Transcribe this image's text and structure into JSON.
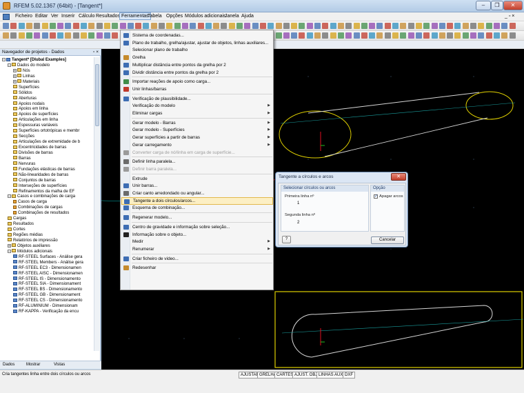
{
  "window": {
    "title": "RFEM 5.02.1367 (64bit) - [Tangent*]",
    "minimize": "–",
    "maximize": "❐",
    "close": "✕"
  },
  "menubar": {
    "items": [
      "Ficheiro",
      "Editar",
      "Ver",
      "Inserir",
      "Cálculo",
      "Resultados",
      "Ferramentas",
      "Tabela",
      "Opções",
      "Módulos adicionais",
      "Janela",
      "Ajuda"
    ],
    "active": "Ferramentas",
    "mdi_controls": "_ ▫ ×"
  },
  "navigator": {
    "title": "Navegador de projetos - Dados",
    "close": "▫ ×",
    "tree": [
      {
        "label": "Tangent* [Dlubal Examples]",
        "level": 0,
        "bold": true,
        "icon": "doc",
        "expander": "−"
      },
      {
        "label": "Dados do modelo",
        "level": 1,
        "icon": "folder",
        "expander": "−"
      },
      {
        "label": "Nós",
        "level": 2,
        "icon": "folder",
        "expander": "+"
      },
      {
        "label": "Linhas",
        "level": 2,
        "icon": "folder",
        "expander": "+"
      },
      {
        "label": "Materiais",
        "level": 2,
        "icon": "folder",
        "expander": "+"
      },
      {
        "label": "Superfícies",
        "level": 2,
        "icon": "folder"
      },
      {
        "label": "Sólidos",
        "level": 2,
        "icon": "folder"
      },
      {
        "label": "Aberturas",
        "level": 2,
        "icon": "folder"
      },
      {
        "label": "Apoios nodais",
        "level": 2,
        "icon": "folder"
      },
      {
        "label": "Apoios em linha",
        "level": 2,
        "icon": "folder"
      },
      {
        "label": "Apoios de superfícies",
        "level": 2,
        "icon": "folder"
      },
      {
        "label": "Articulações em linha",
        "level": 2,
        "icon": "folder"
      },
      {
        "label": "Espessuras variáveis",
        "level": 2,
        "icon": "folder"
      },
      {
        "label": "Superfícies ortotrópicas e membr",
        "level": 2,
        "icon": "folder"
      },
      {
        "label": "Secções",
        "level": 2,
        "icon": "folder"
      },
      {
        "label": "Articulações de extremidade de b",
        "level": 2,
        "icon": "folder"
      },
      {
        "label": "Excentricidades de barras",
        "level": 2,
        "icon": "folder"
      },
      {
        "label": "Divisões de barras",
        "level": 2,
        "icon": "folder"
      },
      {
        "label": "Barras",
        "level": 2,
        "icon": "folder"
      },
      {
        "label": "Nervuras",
        "level": 2,
        "icon": "folder"
      },
      {
        "label": "Fundações elásticas de barras",
        "level": 2,
        "icon": "folder"
      },
      {
        "label": "Não-linearidades de barras",
        "level": 2,
        "icon": "folder"
      },
      {
        "label": "Conjuntos de barras",
        "level": 2,
        "icon": "folder"
      },
      {
        "label": "Interseções de superfícies",
        "level": 2,
        "icon": "folder"
      },
      {
        "label": "Refinamentos da malha de EF",
        "level": 2,
        "icon": "folder"
      },
      {
        "label": "Casos e combinações de carga",
        "level": 1,
        "icon": "folder",
        "expander": "−"
      },
      {
        "label": "Casos de carga",
        "level": 2,
        "icon": "item"
      },
      {
        "label": "Combinações de cargas",
        "level": 2,
        "icon": "item"
      },
      {
        "label": "Combinações de resultados",
        "level": 2,
        "icon": "item"
      },
      {
        "label": "Cargas",
        "level": 1,
        "icon": "folder"
      },
      {
        "label": "Resultados",
        "level": 1,
        "icon": "folder"
      },
      {
        "label": "Cortes",
        "level": 1,
        "icon": "folder"
      },
      {
        "label": "Regiões médias",
        "level": 1,
        "icon": "folder"
      },
      {
        "label": "Relatórios de impressão",
        "level": 1,
        "icon": "folder"
      },
      {
        "label": "Objetos auxiliares",
        "level": 1,
        "icon": "folder",
        "expander": "+"
      },
      {
        "label": "Módulos adicionais",
        "level": 1,
        "icon": "folder",
        "expander": "−"
      },
      {
        "label": "RF-STEEL Surfaces - Análise gera",
        "level": 2,
        "icon": "doc"
      },
      {
        "label": "RF-STEEL Members - Análise gera",
        "level": 2,
        "icon": "doc"
      },
      {
        "label": "RF-STEEL EC3 - Dimensionamen",
        "level": 2,
        "icon": "doc"
      },
      {
        "label": "RF-STEEL AISC - Dimensionamen",
        "level": 2,
        "icon": "doc"
      },
      {
        "label": "RF-STEEL IS - Dimensionamento",
        "level": 2,
        "icon": "doc"
      },
      {
        "label": "RF-STEEL SIA - Dimensionament",
        "level": 2,
        "icon": "doc"
      },
      {
        "label": "RF-STEEL BS - Dimensionamento",
        "level": 2,
        "icon": "doc"
      },
      {
        "label": "RF-STEEL GB - Dimensionament",
        "level": 2,
        "icon": "doc"
      },
      {
        "label": "RF-STEEL CS - Dimensionamento",
        "level": 2,
        "icon": "doc"
      },
      {
        "label": "RF-ALUMINIUM - Dimensionam",
        "level": 2,
        "icon": "doc"
      },
      {
        "label": "RF-KAPPA - Verificação da encu",
        "level": 2,
        "icon": "doc"
      }
    ],
    "tabs": [
      "Dados",
      "Mostrar",
      "Vistas"
    ]
  },
  "tools_menu": {
    "items": [
      {
        "label": "Sistema de coordenadas...",
        "icon": "#3d6db3"
      },
      {
        "label": "Plano de trabalho, grelha/ajustar, ajustar de objetos, linhas auxiliares...",
        "icon": "#3d6db3"
      },
      {
        "label": "Selecionar plano de trabalho",
        "icon": ""
      },
      {
        "label": "Grelha",
        "icon": "#c58a2c"
      },
      {
        "label": "Multiplicar distância entre pontos da grelha por 2",
        "icon": "#3d6db3"
      },
      {
        "label": "Dividir distância entre pontos da grelha por 2",
        "icon": "#3d6db3"
      },
      {
        "sep": true
      },
      {
        "label": "Importar reações de apoio como carga...",
        "icon": "#3f8d4a"
      },
      {
        "label": "Unir linhas/barras",
        "icon": "#c0392b"
      },
      {
        "sep": true
      },
      {
        "label": "Verificação de plausibilidade...",
        "icon": "#3d6db3"
      },
      {
        "label": "Verificação do modelo",
        "icon": "",
        "submenu": true
      },
      {
        "label": "Eliminar cargas",
        "icon": "",
        "submenu": true
      },
      {
        "sep": true
      },
      {
        "label": "Gerar modelo - Barras",
        "icon": "",
        "submenu": true
      },
      {
        "label": "Gerar modelo - Superfícies",
        "icon": "",
        "submenu": true
      },
      {
        "label": "Gerar superfícies a partir de barras",
        "icon": "",
        "submenu": true
      },
      {
        "label": "Gerar carregamento",
        "icon": "",
        "submenu": true
      },
      {
        "label": "Converter carga de nó/linha em carga de superfície...",
        "icon": "#9a9a9a",
        "disabled": true
      },
      {
        "sep": true
      },
      {
        "label": "Definir linha paralela...",
        "icon": "#6b6b6b"
      },
      {
        "label": "Definir barra paralela...",
        "icon": "#9a9a9a",
        "disabled": true
      },
      {
        "sep": true
      },
      {
        "label": "Extrude",
        "icon": ""
      },
      {
        "label": "Unir barras...",
        "icon": "#3d6db3"
      },
      {
        "label": "Criar canto arredondado ou angular...",
        "icon": "#6b6b6b"
      },
      {
        "label": "Tangente a dois círculos/arcos...",
        "icon": "#3d6db3",
        "highlight": true
      },
      {
        "label": "Esquema de combinação...",
        "icon": "#3d6db3"
      },
      {
        "sep": true
      },
      {
        "label": "Regenerar modelo...",
        "icon": "#3d6db3"
      },
      {
        "sep": true
      },
      {
        "label": "Centro de gravidade e informação sobre seleção...",
        "icon": "#3d6db3"
      },
      {
        "label": "Informação sobre o objeto...",
        "icon": "#222222"
      },
      {
        "label": "Medir",
        "icon": "",
        "submenu": true
      },
      {
        "label": "Renumerar",
        "icon": "",
        "submenu": true
      },
      {
        "sep": true
      },
      {
        "label": "Criar ficheiro de vídeo...",
        "icon": "#3d6db3"
      },
      {
        "sep": true
      },
      {
        "label": "Redesenhar",
        "icon": "#c58a2c"
      }
    ]
  },
  "dialog": {
    "title": "Tangente a círculos e arcos",
    "close": "✕",
    "select_group": "Selecionar círculos ou arcos",
    "first_line_label": "Primeira linha nº",
    "first_line_value": "1",
    "second_line_label": "Segunda linha nº",
    "second_line_value": "2",
    "option_group": "Opção",
    "delete_arcs_label": "Apagar arcos",
    "delete_arcs_checked": "✓",
    "help": "?",
    "cancel": "Cancelar"
  },
  "statusbar": {
    "text": "Cria tangentes linha entre dois círculos ou arcos",
    "buttons": [
      "AJUSTAR",
      "GRELHA",
      "CARTES",
      "AJUST. OBJ.",
      "LINHAS AUX.",
      "DXF"
    ]
  },
  "colors": {
    "viewport_bg": "#000000",
    "model_line": "#ffff00",
    "tangent_line": "#d8d8d8",
    "pointer_arrow": "#d0102a",
    "menu_highlight": "#fcefc4"
  }
}
